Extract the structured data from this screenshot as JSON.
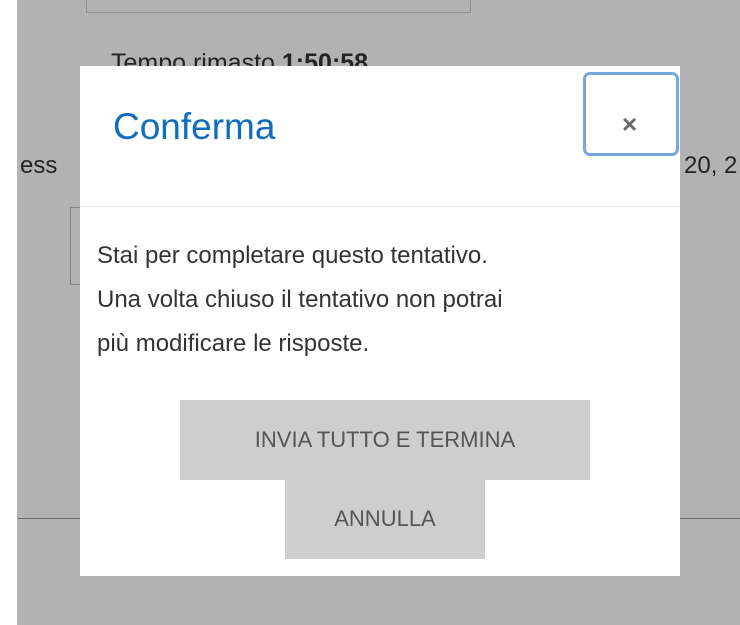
{
  "background": {
    "timer_label": "Tempo rimasto",
    "timer_value": "1:50:58",
    "left_fragment": "e ess",
    "right_fragment": "20, 2"
  },
  "modal": {
    "title": "Conferma",
    "close_icon": "close-icon",
    "close_glyph": "×",
    "body_line_1": "Stai per completare questo tentativo.",
    "body_line_2": "Una volta chiuso il tentativo non potrai",
    "body_line_3": "più modificare le risposte.",
    "submit_label": "INVIA TUTTO E TERMINA",
    "cancel_label": "ANNULLA"
  },
  "colors": {
    "title": "#0f6cbf",
    "close_focus_ring": "#72a8dc",
    "button_bg": "#cecece",
    "overlay": "rgba(0,0,0,0.30)"
  }
}
